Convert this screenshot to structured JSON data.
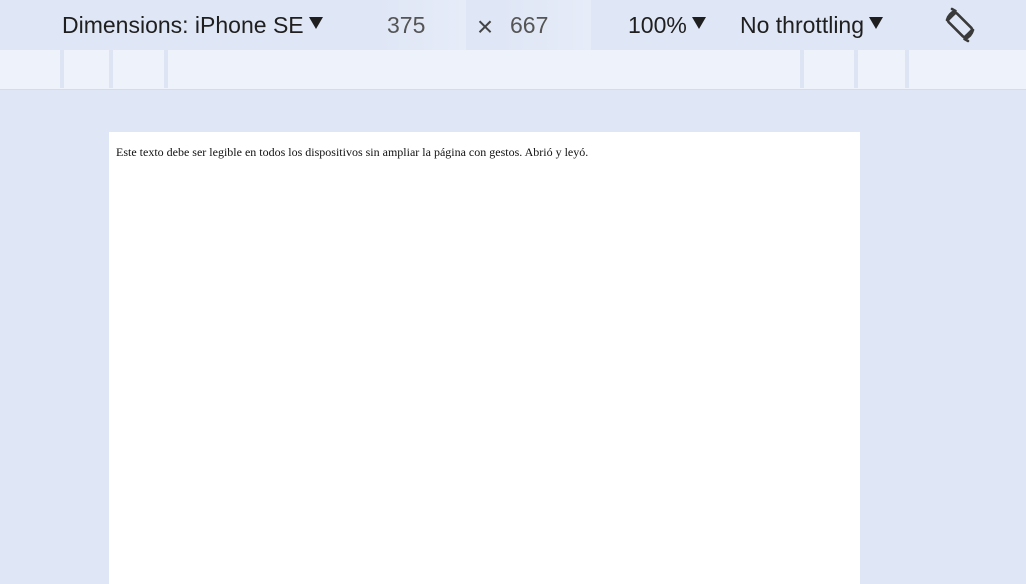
{
  "toolbar": {
    "dimensions_label": "Dimensions: iPhone SE",
    "width_value": "375",
    "times_symbol": "×",
    "height_value": "667",
    "zoom_label": "100%",
    "throttling_label": "No throttling",
    "rotate_icon": "rotate-icon",
    "caret_icon": "caret-down-icon"
  },
  "colors": {
    "toolbar_bg": "#dfe6f5",
    "mq_bar_bg": "#eef2fa",
    "mq_divider": "#dde4f3",
    "viewport_bg": "#ffffff",
    "text": "#1f1f1f"
  },
  "viewport": {
    "body_text": "Este texto debe ser legible en todos los dispositivos sin ampliar la página con gestos. Abrió y leyó."
  }
}
